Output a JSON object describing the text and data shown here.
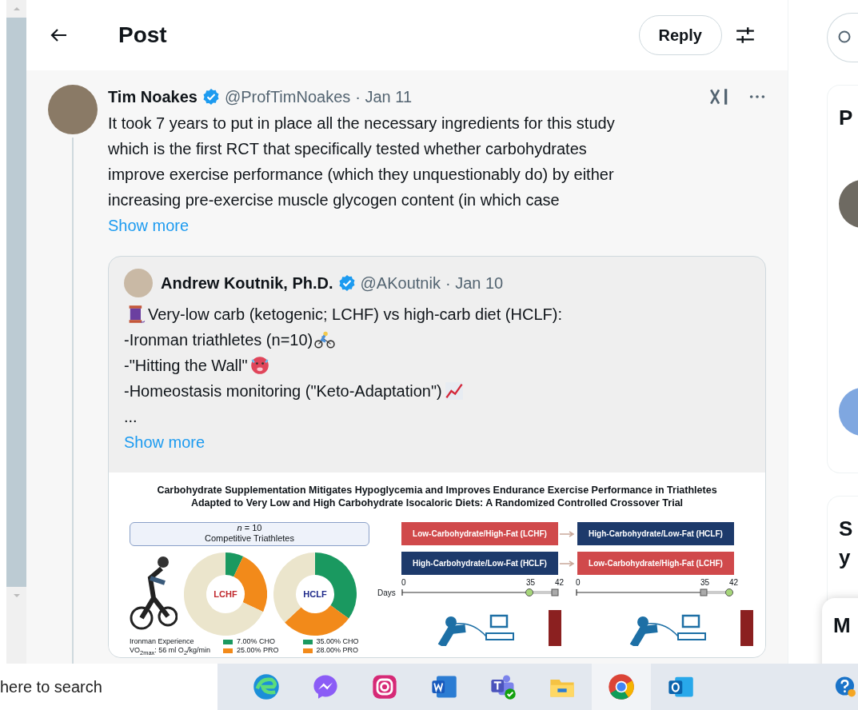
{
  "header": {
    "title": "Post",
    "reply_button": "Reply"
  },
  "post": {
    "author": "Tim Noakes",
    "verified": true,
    "handle": "@ProfTimNoakes",
    "date": "· Jan 11",
    "text_lines": [
      "It took 7 years to put in place all the necessary ingredients for this study",
      "which is the first RCT that specifically tested whether carbohydrates",
      "improve exercise performance (which they unquestionably do) by either",
      "increasing pre-exercise muscle glycogen content (in which case"
    ],
    "show_more": "Show more",
    "quote": {
      "author": "Andrew Koutnik, Ph.D.",
      "verified": true,
      "handle": "@AKoutnik",
      "date": "· Jan 10",
      "lines": [
        [
          {
            "kind": "spool"
          },
          {
            "kind": "text",
            "text": "Very-low carb (ketogenic; LCHF) vs high-carb diet (HCLF):"
          }
        ],
        [
          {
            "kind": "text",
            "text": "-Ironman triathletes (n=10)"
          },
          {
            "kind": "cyclist"
          }
        ],
        [
          {
            "kind": "text",
            "text": "-\"Hitting the Wall\""
          },
          {
            "kind": "hot-face"
          }
        ],
        [
          {
            "kind": "text",
            "text": "-Homeostasis monitoring (\"Keto-Adaptation\")"
          },
          {
            "kind": "chart"
          }
        ],
        [
          {
            "kind": "text",
            "text": "..."
          }
        ]
      ],
      "show_more": "Show more",
      "figure": {
        "title_lines": [
          "Carbohydrate Supplementation Mitigates Hypoglycemia and Improves Endurance Exercise Performance in Triathletes",
          "Adapted to Very Low and High Carbohydrate Isocaloric Diets: A Randomized Controlled Crossover Trial"
        ],
        "cohort": {
          "n": "*n* = 10",
          "label": "Competitive Triathletes"
        },
        "diets": [
          {
            "label": "LCHF",
            "color": "#c0282d"
          },
          {
            "label": "HCLF",
            "color": "#1f2a8a"
          }
        ],
        "athlete_info": [
          "Ironman Experience",
          "VO$_{2max}$: 56 ml O$_{2}$/kg/min"
        ],
        "legends": [
          [
            {
              "text": "7.00% CHO",
              "color": "#1a9960"
            },
            {
              "text": "25.00% PRO",
              "color": "#f28a1a"
            }
          ],
          [
            {
              "text": "35.00% CHO",
              "color": "#1a9960"
            },
            {
              "text": "28.00% PRO",
              "color": "#f28a1a"
            }
          ]
        ],
        "arms": [
          [
            {
              "label": "Low-Carbohydrate/High-Fat (LCHF)",
              "color": "#d0494b"
            },
            {
              "label": "High-Carbohydrate/Low-Fat (HCLF)",
              "color": "#1d3a6b"
            }
          ],
          [
            {
              "label": "High-Carbohydrate/Low-Fat (HCLF)",
              "color": "#1d3a6b"
            },
            {
              "label": "Low-Carbohydrate/High-Fat (LCHF)",
              "color": "#d0494b"
            }
          ]
        ],
        "timeline": {
          "axis_label": "Days",
          "axes": [
            [
              "0",
              "35",
              "42"
            ],
            [
              "0",
              "35",
              "42"
            ]
          ]
        }
      }
    }
  },
  "sidebar": {
    "card_heading": "P",
    "card2_heading_lines": [
      "S",
      "y"
    ],
    "messages_title": "M"
  },
  "taskbar": {
    "search_placeholder": "here to search",
    "apps": [
      {
        "kind": "edge",
        "selected": false
      },
      {
        "kind": "messenger",
        "selected": false
      },
      {
        "kind": "instagram",
        "selected": false
      },
      {
        "kind": "word",
        "selected": false
      },
      {
        "kind": "teams",
        "selected": false
      },
      {
        "kind": "folder",
        "selected": false
      },
      {
        "kind": "chrome",
        "selected": true
      },
      {
        "kind": "outlook",
        "selected": false
      }
    ]
  }
}
